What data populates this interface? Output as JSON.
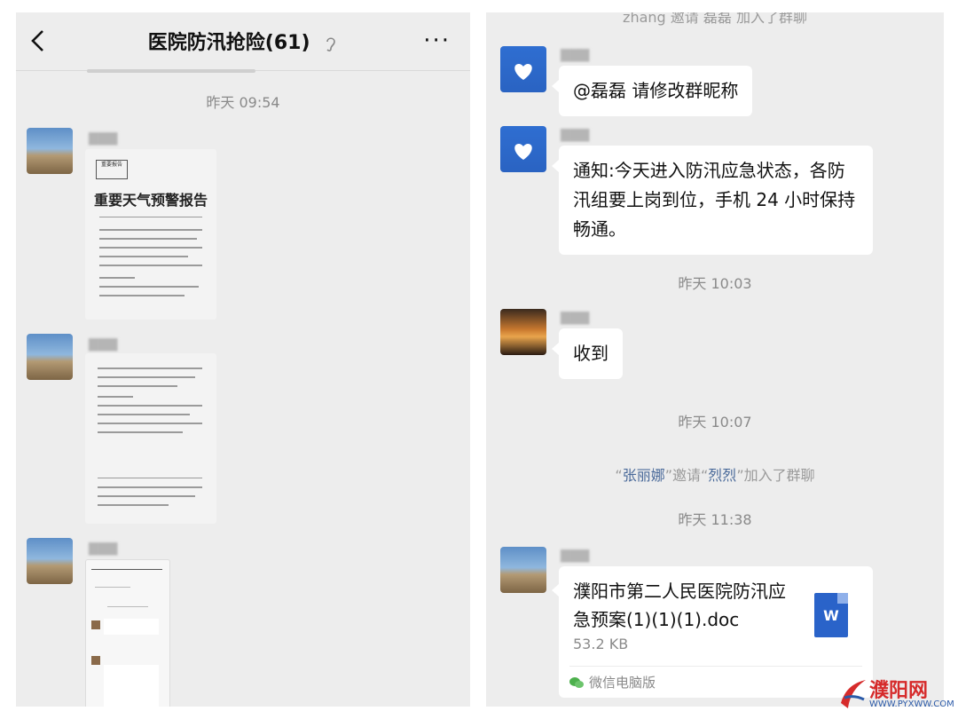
{
  "left": {
    "title": "医院防汛抢险(61)",
    "more": "···",
    "timestamp": "昨天 09:54",
    "doc": {
      "stamp": "重要报告",
      "heading": "重要天气预警报告"
    }
  },
  "right": {
    "top_partial": "zhang 邀请 磊磊 加入了群聊",
    "messages": [
      {
        "text": "@磊磊 请修改群昵称"
      },
      {
        "text": "通知:今天进入防汛应急状态，各防汛组要上岗到位，手机 24 小时保持畅通。"
      },
      {
        "text": "收到"
      }
    ],
    "ts1": "昨天 10:03",
    "ts2": "昨天 10:07",
    "sys": {
      "q1": "“",
      "inviter": "张丽娜",
      "mid": "”邀请“",
      "invitee": "烈烈",
      "end": "”加入了群聊"
    },
    "ts3": "昨天 11:38",
    "file": {
      "name": "濮阳市第二人民医院防汛应急预案(1)(1)(1).doc",
      "size": "53.2 KB",
      "icon_letter": "W",
      "source": "微信电脑版"
    }
  },
  "watermark": {
    "name": "濮阳网",
    "url": "WWW.PYXWW.COM"
  }
}
